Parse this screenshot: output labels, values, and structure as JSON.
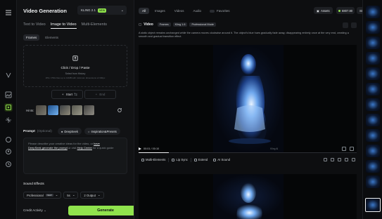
{
  "panel": {
    "title": "Video Generation",
    "model": {
      "name": "KLING 2.1",
      "badge": "NEW"
    },
    "modes": [
      "Text to Video",
      "Image to Video",
      "Multi-Elements"
    ],
    "subtabs": [
      "Frames",
      "Elements"
    ],
    "upload": {
      "label": "Click / Drop / Paste",
      "sub": "Select from History",
      "hint": "JPG / PNG files up to 10MB with minimum dimensions of 300px",
      "hint2": ""
    },
    "frames": {
      "start": "Start",
      "end": "End"
    },
    "hints_label": "Hints:",
    "prompt": {
      "label": "Prompt",
      "optional": "(Optional)",
      "deepseek": "DeepSeek",
      "inspiration": "Inspiration&Presets",
      "placeholder_1": "Please describe your creative ideas for the video, or ",
      "link_have": "have",
      "link_deepseek": "DeepSeek generate the prompt",
      "placeholder_2": " or visit ",
      "link_help": "Help Center",
      "placeholder_3": " for a quick guide"
    },
    "sound_label": "Sound Effects",
    "settings": {
      "mode": "Professional",
      "mode_tag": "NEW",
      "duration": "5s",
      "outputs": "2 Output"
    },
    "credit_label": "Credit Activity",
    "generate_label": "Generate"
  },
  "main": {
    "filters": [
      "All",
      "Images",
      "Videos",
      "Audio"
    ],
    "favorites": "Favorites",
    "assets": "Assets",
    "credits": "6807.80",
    "plan": "Standard",
    "video": {
      "label": "Video",
      "tags": [
        "Frames",
        "Kling 1.6",
        "Professional Mode"
      ],
      "description": "A static object remains unchanged while the camera moves clockwise around it. The object's blue hues gradually fade away, disappearing entirely once at the very end, creating a smooth and gradual transition effect."
    },
    "player": {
      "time": "00:01 / 00:10",
      "watermark": "Kling AI",
      "progress": 0.14
    },
    "actions": [
      "Multi-Elements",
      "Lip Sync",
      "Extend",
      "AI Sound"
    ]
  },
  "colors": {
    "accent": "#90e34d",
    "glow": "#3b78c9"
  }
}
